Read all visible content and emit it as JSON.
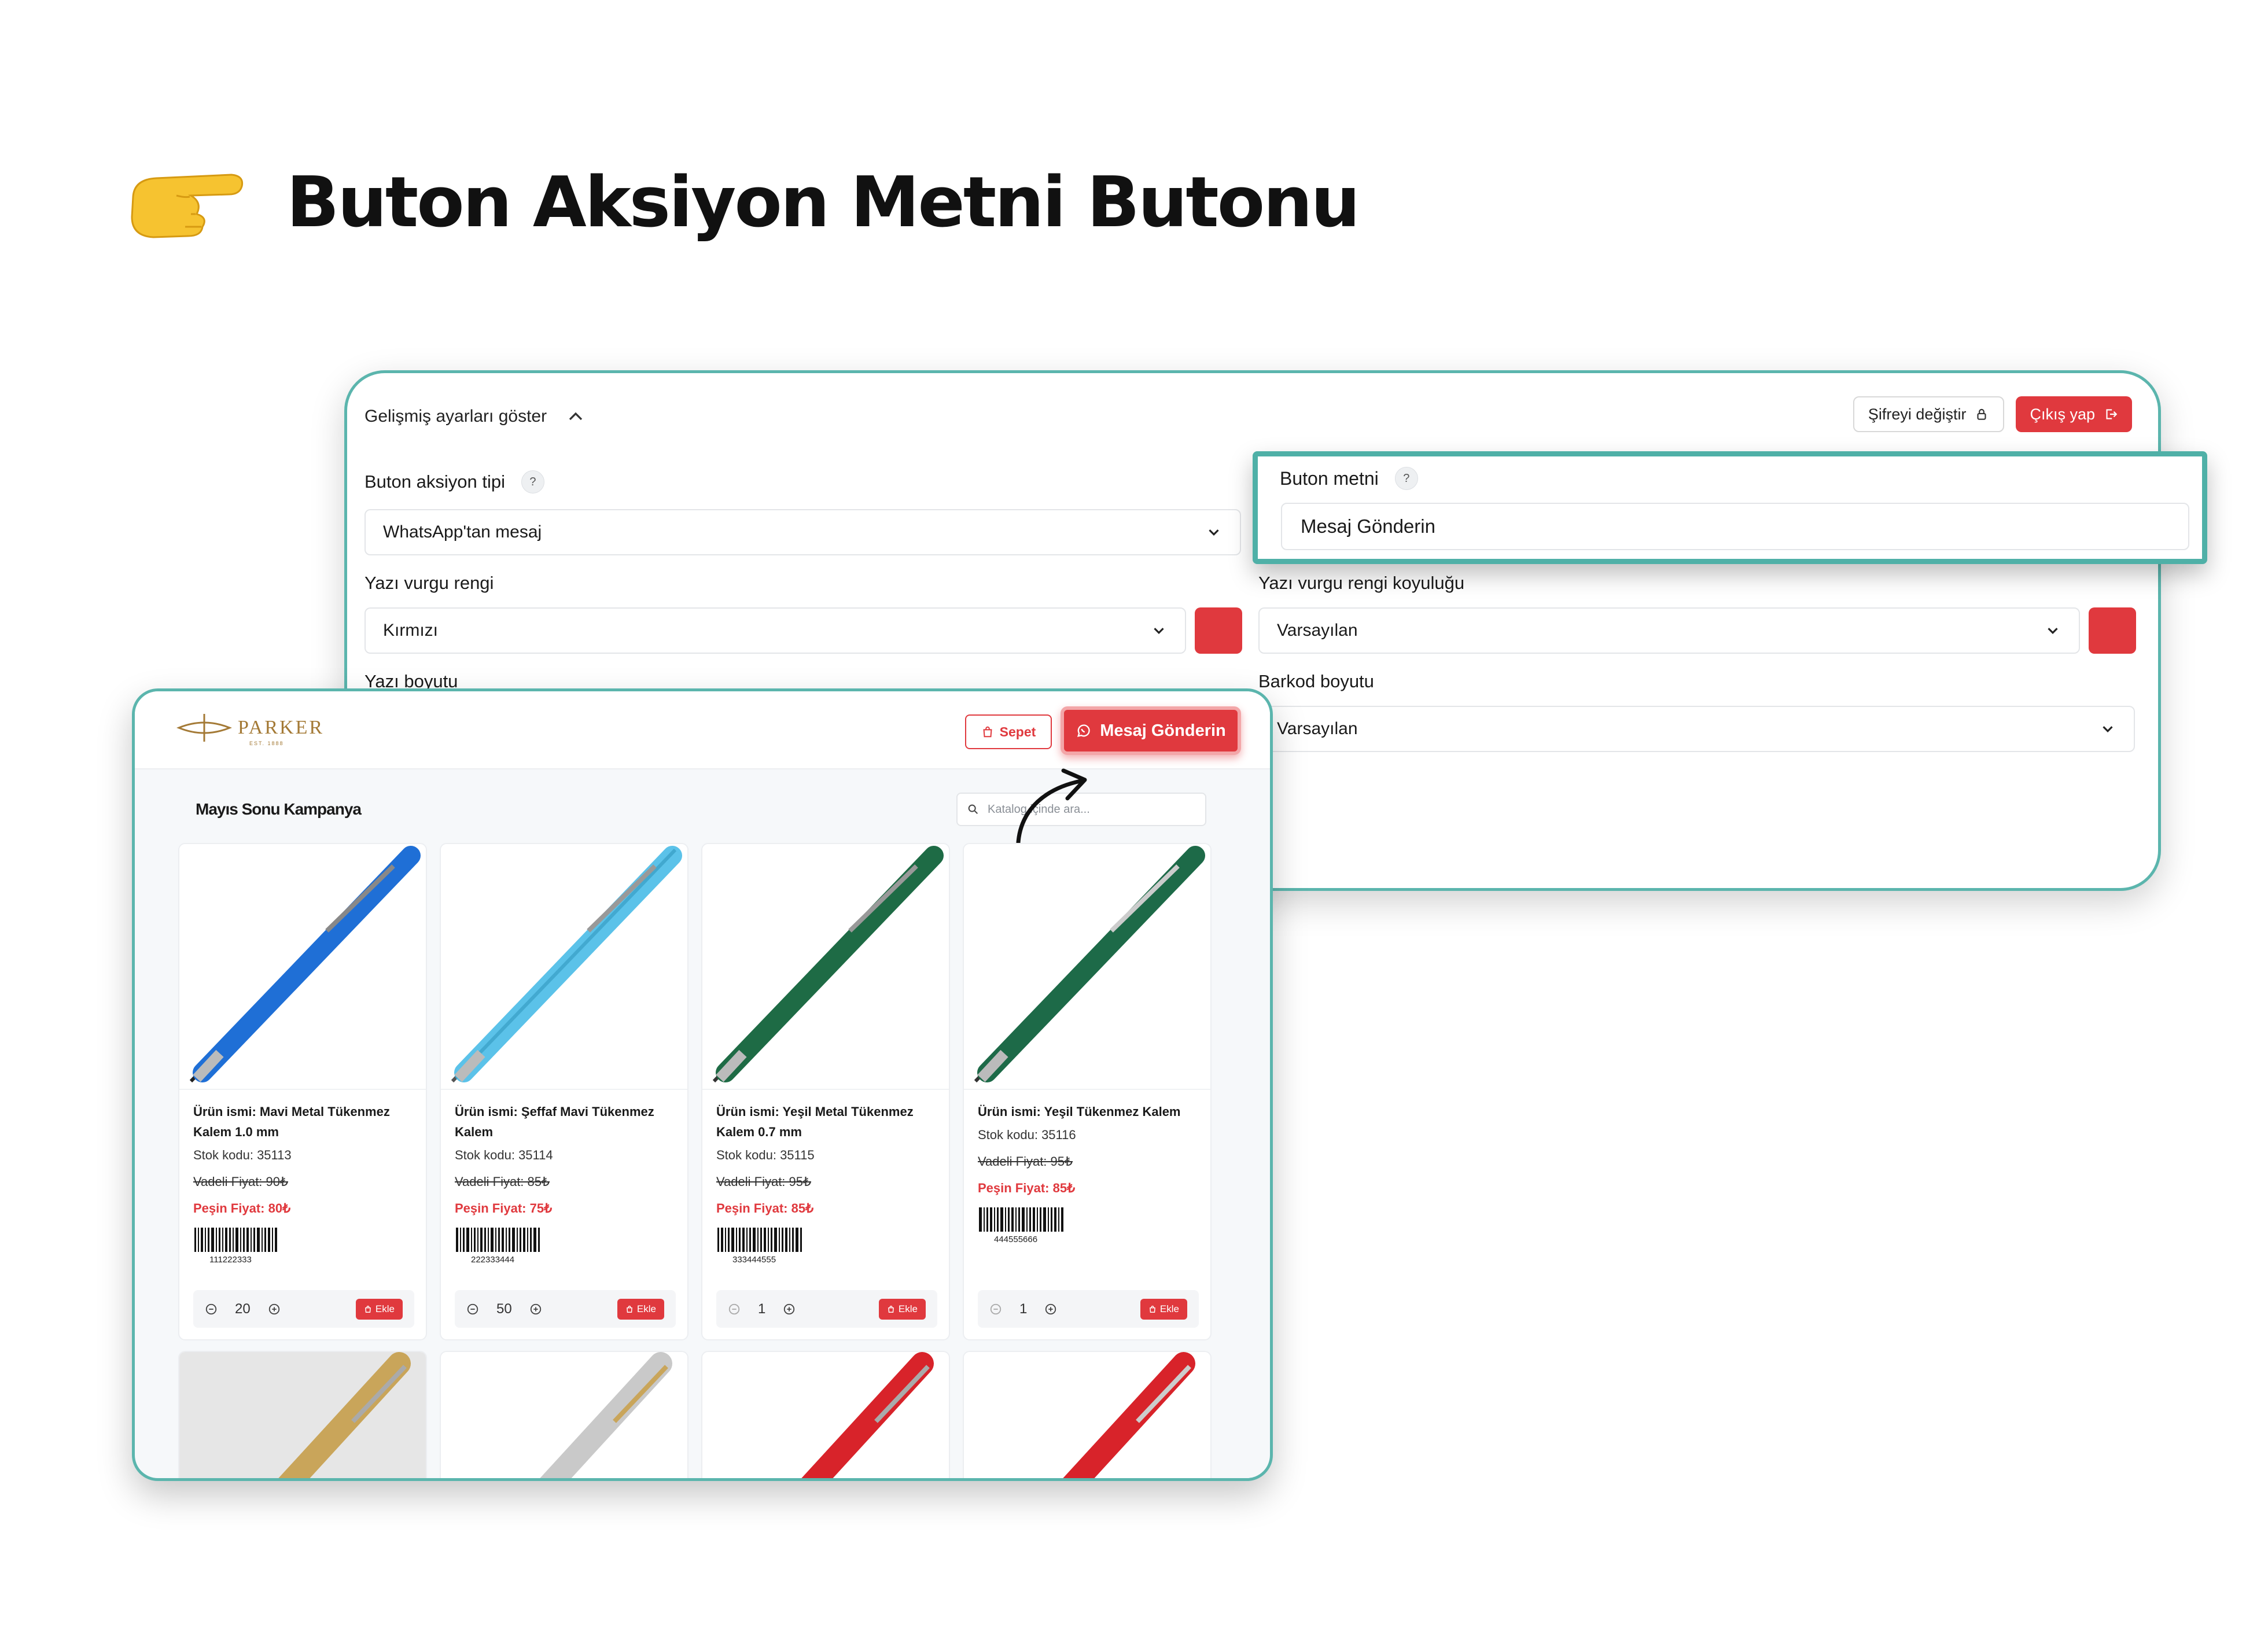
{
  "heading": {
    "title": "Buton Aksiyon Metni Butonu",
    "icon": "pointing-hand-icon"
  },
  "settings": {
    "advanced_toggle": "Gelişmiş ayarları göster",
    "change_password": "Şifreyi değiştir",
    "logout": "Çıkış yap",
    "action_type_label": "Buton aksiyon tipi",
    "action_type_value": "WhatsApp'tan mesaj",
    "button_text_label": "Buton metni",
    "button_text_value": "Mesaj Gönderin",
    "accent_color_label": "Yazı vurgu rengi",
    "accent_color_value": "Kırmızı",
    "accent_shade_label": "Yazı vurgu rengi koyuluğu",
    "accent_shade_value": "Varsayılan",
    "font_size_label": "Yazı boyutu",
    "barcode_size_label": "Barkod boyutu",
    "barcode_size_value": "Varsayılan",
    "help": "?",
    "accent_hex": "#e0393e"
  },
  "catalog": {
    "brand": "PARKER",
    "brand_sub": "EST. 1888",
    "cart": "Sepet",
    "message_button": "Mesaj Gönderin",
    "campaign_title": "Mayıs Sonu Kampanya",
    "search_placeholder": "Katalog içinde ara...",
    "add_label": "Ekle",
    "products": [
      {
        "name": "Ürün ismi: Mavi Metal Tükenmez Kalem 1.0 mm",
        "stock": "Stok kodu: 35113",
        "term_price": "Vadeli Fiyat: 90₺",
        "cash_price": "Peşin Fiyat: 80₺",
        "barcode": "111222333",
        "qty": "20",
        "color": "#1f6fd6"
      },
      {
        "name": "Ürün ismi: Şeffaf Mavi Tükenmez Kalem",
        "stock": "Stok kodu: 35114",
        "term_price": "Vadeli Fiyat: 85₺",
        "cash_price": "Peşin Fiyat: 75₺",
        "barcode": "222333444",
        "qty": "50",
        "color": "#3fb8e6"
      },
      {
        "name": "Ürün ismi: Yeşil Metal Tükenmez Kalem 0.7 mm",
        "stock": "Stok kodu: 35115",
        "term_price": "Vadeli Fiyat: 95₺",
        "cash_price": "Peşin Fiyat: 85₺",
        "barcode": "333444555",
        "qty": "1",
        "color": "#1e6b45"
      },
      {
        "name": "Ürün ismi: Yeşil Tükenmez Kalem",
        "stock": "Stok kodu: 35116",
        "term_price": "Vadeli Fiyat: 95₺",
        "cash_price": "Peşin Fiyat: 85₺",
        "barcode": "444555666",
        "qty": "1",
        "color": "#1d6a48"
      }
    ]
  }
}
